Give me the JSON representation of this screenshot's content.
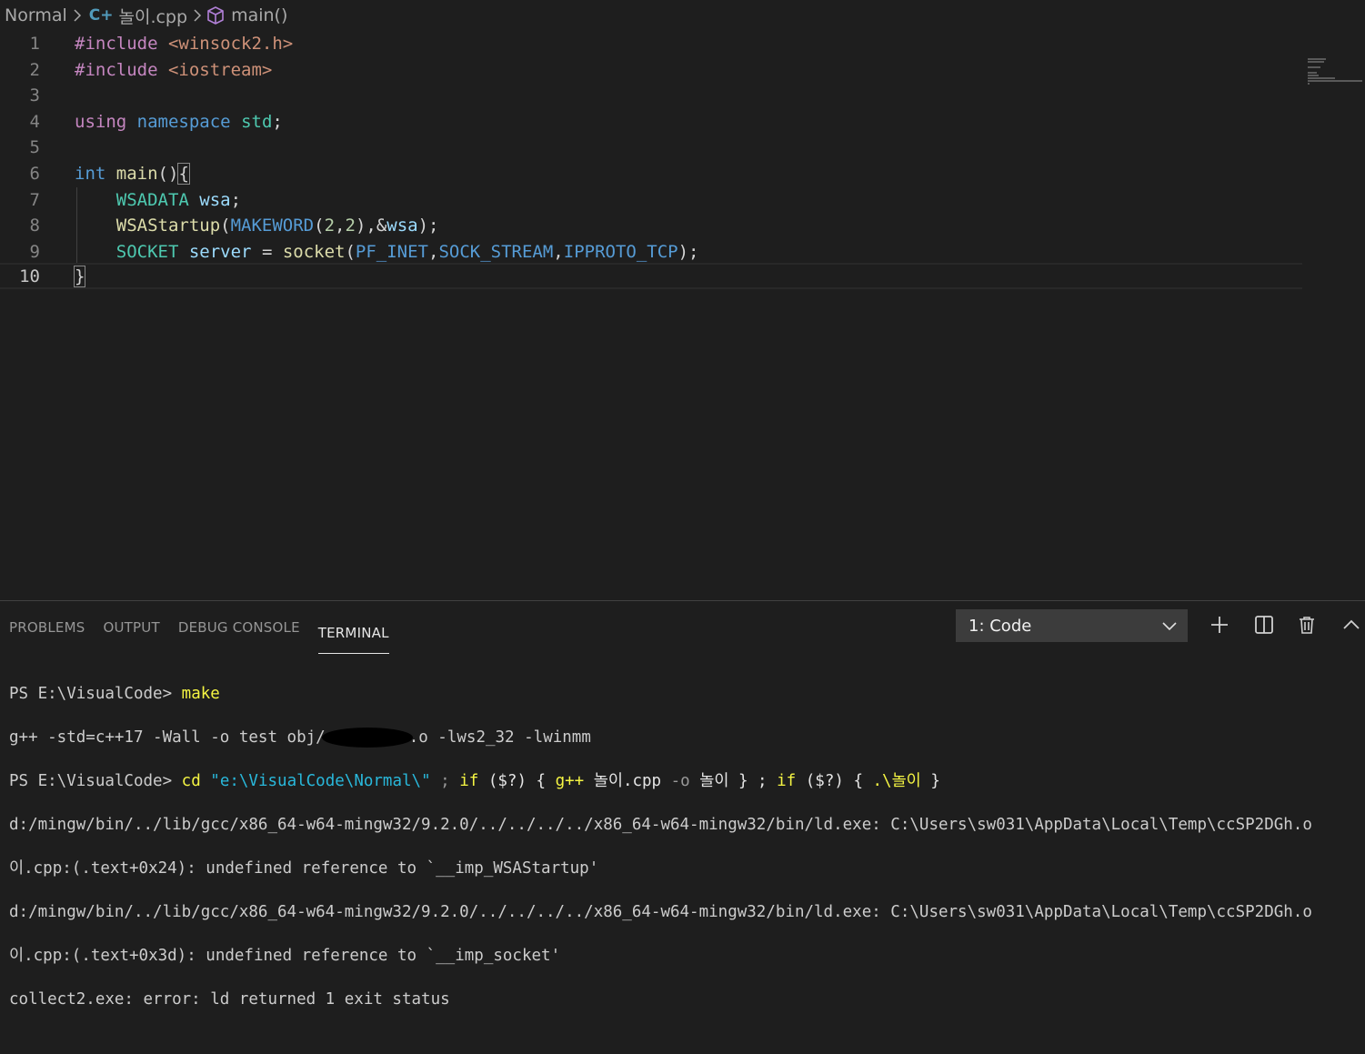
{
  "breadcrumb": {
    "folder": "Normal",
    "file_icon": "cpp-file-icon",
    "file": "놀이.cpp",
    "symbol_icon": "cube-method-icon",
    "symbol": "main()"
  },
  "editor": {
    "line_numbers": [
      "1",
      "2",
      "3",
      "4",
      "5",
      "6",
      "7",
      "8",
      "9",
      "10"
    ],
    "lines": [
      [
        "#include",
        " ",
        "<winsock2.h>"
      ],
      [
        "#include",
        " ",
        "<iostream>"
      ],
      [
        ""
      ],
      [
        "using",
        " ",
        "namespace",
        " ",
        "std",
        ";"
      ],
      [
        ""
      ],
      [
        "int",
        " ",
        "main",
        "()",
        "{"
      ],
      [
        "    ",
        "WSADATA",
        " ",
        "wsa",
        ";"
      ],
      [
        "    ",
        "WSAStartup",
        "(",
        "MAKEWORD",
        "(",
        "2",
        ",",
        "2",
        "),&",
        "wsa",
        ");"
      ],
      [
        "    ",
        "SOCKET",
        " ",
        "server",
        " = ",
        "socket",
        "(",
        "PF_INET",
        ",",
        "SOCK_STREAM",
        ",",
        "IPPROTO_TCP",
        ");"
      ],
      [
        "}"
      ]
    ]
  },
  "panel": {
    "tabs": [
      "PROBLEMS",
      "OUTPUT",
      "DEBUG CONSOLE",
      "TERMINAL"
    ],
    "active_tab": "TERMINAL",
    "terminal_select": "1: Code",
    "icons": [
      "plus-icon",
      "split-terminal-icon",
      "trash-icon",
      "chevron-up-icon"
    ]
  },
  "terminal": {
    "l1_prompt": "PS E:\\VisualCode> ",
    "l1_cmd": "make",
    "l2_a": "g++ -std=c++17 -Wall -o test obj/",
    "l2_b": ".o -lws2_32 -lwinmm",
    "l3_prompt": "PS E:\\VisualCode> ",
    "l3_cd": "cd",
    "l3_path": "\"e:\\VisualCode\\Normal\\\"",
    "l3_semi1": " ; ",
    "l3_if1": "if",
    "l3_cond1": " ($?) ",
    "l3_brace1": "{ ",
    "l3_gpp": "g++",
    "l3_src": " 놀이.cpp ",
    "l3_o": "-o",
    "l3_out": " 놀이 ",
    "l3_brace2": "} ; ",
    "l3_if2": "if",
    "l3_cond2": " ($?) ",
    "l3_brace3": "{ ",
    "l3_run": ".\\놀이",
    "l3_brace4": " }",
    "l4": "d:/mingw/bin/../lib/gcc/x86_64-w64-mingw32/9.2.0/../../../../x86_64-w64-mingw32/bin/ld.exe: C:\\Users\\sw031\\AppData\\Local\\Temp\\ccSP2DGh.o",
    "l5": "이.cpp:(.text+0x24): undefined reference to `__imp_WSAStartup'",
    "l6": "d:/mingw/bin/../lib/gcc/x86_64-w64-mingw32/9.2.0/../../../../x86_64-w64-mingw32/bin/ld.exe: C:\\Users\\sw031\\AppData\\Local\\Temp\\ccSP2DGh.o",
    "l7": "이.cpp:(.text+0x3d): undefined reference to `__imp_socket'",
    "l8": "collect2.exe: error: ld returned 1 exit status"
  }
}
